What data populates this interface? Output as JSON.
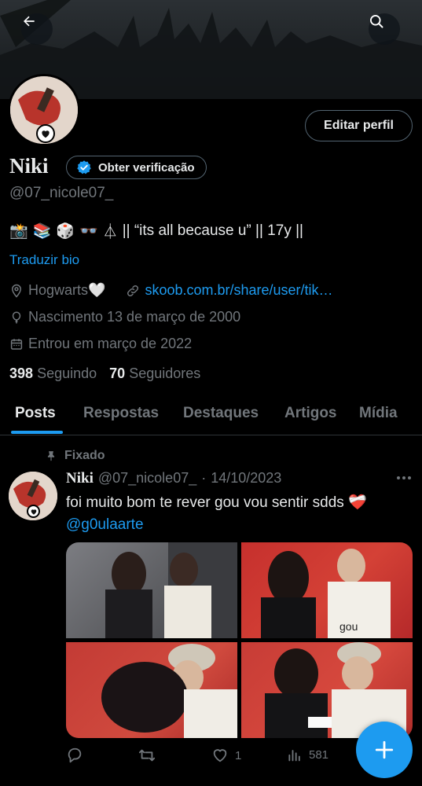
{
  "profile": {
    "name": "Niki",
    "verify_label": "Obter verificação",
    "handle": "@07_nicole07_",
    "edit_label": "Editar perfil",
    "bio_emojis": [
      "📸",
      "📚",
      "🎲",
      "👓",
      "⏃"
    ],
    "bio_text": "|| “its all because u” || 17y ||",
    "translate_label": "Traduzir bio",
    "location": "Hogwarts🤍",
    "website": "skoob.com.br/share/user/tik…",
    "birth": "Nascimento 13 de março de 2000",
    "joined": "Entrou em março de 2022",
    "following_count": "398",
    "following_label": "Seguindo",
    "followers_count": "70",
    "followers_label": "Seguidores"
  },
  "tabs": [
    {
      "label": "Posts",
      "active": true
    },
    {
      "label": "Respostas",
      "active": false
    },
    {
      "label": "Destaques",
      "active": false
    },
    {
      "label": "Artigos",
      "active": false
    },
    {
      "label": "Mídia",
      "active": false
    }
  ],
  "pinned_tweet": {
    "pinned_label": "Fixado",
    "author_name": "Niki",
    "author_handle": "@07_nicole07_",
    "separator": "·",
    "date": "14/10/2023",
    "text": "foi muito bom te rever gou vou sentir sdds ❤️‍🩹",
    "mention": "@g0ulaarte",
    "replies": "",
    "retweets": "",
    "likes": "1",
    "views": "581"
  },
  "colors": {
    "accent": "#1d9bf0",
    "muted": "#71767b",
    "text": "#e7e9ea",
    "background": "#000000"
  },
  "icons": {
    "back": "arrow-left-icon",
    "search": "search-icon",
    "verified": "verified-badge-icon",
    "location": "location-pin-icon",
    "link": "link-icon",
    "birth": "balloon-icon",
    "calendar": "calendar-icon",
    "pin": "pin-icon",
    "more": "more-horizontal-icon",
    "reply": "reply-icon",
    "retweet": "retweet-icon",
    "like": "heart-icon",
    "views": "views-icon",
    "compose": "plus-icon"
  }
}
